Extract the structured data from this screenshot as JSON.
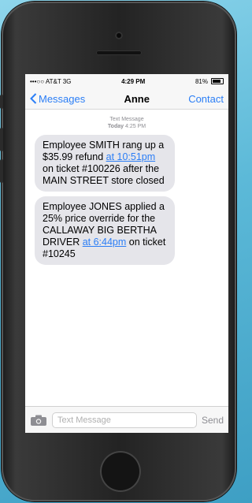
{
  "status": {
    "carrier": "•••○○ AT&T",
    "network": "3G",
    "time": "4:29 PM",
    "battery": "81%"
  },
  "nav": {
    "back_label": "Messages",
    "title": "Anne",
    "contact_label": "Contact"
  },
  "thread_meta": {
    "label": "Text Message",
    "day": "Today",
    "time": "4:25 PM"
  },
  "messages": [
    {
      "pre": "Employee SMITH rang up a $35.99 refund ",
      "link": "at 10:51pm",
      "post": " on ticket #100226 after the MAIN STREET store closed"
    },
    {
      "pre": "Employee JONES applied a 25% price override for the CALLAWAY BIG BERTHA DRIVER ",
      "link": "at 6:44pm",
      "post": " on ticket #10245"
    }
  ],
  "input": {
    "placeholder": "Text Message",
    "send_label": "Send"
  }
}
